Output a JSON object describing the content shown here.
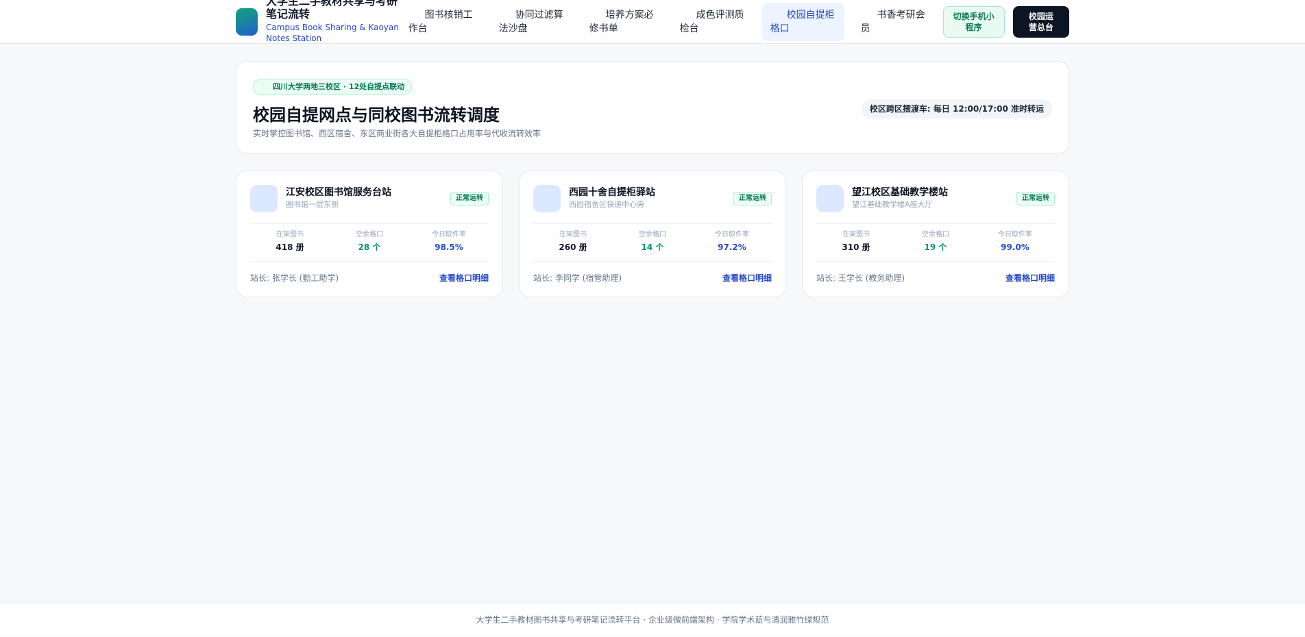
{
  "brand": {
    "title": "大学生二手教材共享与考研笔记流转",
    "subtitle": "Campus Book Sharing & Kaoyan Notes Station"
  },
  "nav": [
    {
      "label": "图书核销工作台",
      "active": false
    },
    {
      "label": "协同过滤算法沙盘",
      "active": false
    },
    {
      "label": "培养方案必修书单",
      "active": false
    },
    {
      "label": "成色评测质检台",
      "active": false
    },
    {
      "label": "校园自提柜格口",
      "active": true
    },
    {
      "label": "书香考研会员",
      "active": false
    }
  ],
  "header_actions": {
    "mini_program": "切换手机小程序",
    "ops": "校园运营总台"
  },
  "hero": {
    "badge": "四川大学两地三校区 · 12处自提点联动",
    "title": "校园自提网点与同校图书流转调度",
    "desc": "实时掌控图书馆、西区宿舍、东区商业街各大自提柜格口占用率与代收流转效率",
    "shuttle": "校区跨区摆渡车: 每日 12:00/17:00 准时转运"
  },
  "stations": [
    {
      "name": "江安校区图书馆服务台站",
      "location": "图书馆一层东侧",
      "status": "正常运转",
      "books_label": "在架图书",
      "books": "418 册",
      "free_label": "空余格口",
      "free": "28 个",
      "rate_label": "今日取件率",
      "rate": "98.5%",
      "manager": "站长: 张学长 (勤工助学)",
      "link": "查看格口明细"
    },
    {
      "name": "西园十舍自提柜驿站",
      "location": "西园宿舍区快递中心旁",
      "status": "正常运转",
      "books_label": "在架图书",
      "books": "260 册",
      "free_label": "空余格口",
      "free": "14 个",
      "rate_label": "今日取件率",
      "rate": "97.2%",
      "manager": "站长: 李同学 (宿管助理)",
      "link": "查看格口明细"
    },
    {
      "name": "望江校区基础教学楼站",
      "location": "望江基础教学楼A座大厅",
      "status": "正常运转",
      "books_label": "在架图书",
      "books": "310 册",
      "free_label": "空余格口",
      "free": "19 个",
      "rate_label": "今日取件率",
      "rate": "99.0%",
      "manager": "站长: 王学长 (教务助理)",
      "link": "查看格口明细"
    }
  ],
  "footer": "大学生二手教材图书共享与考研笔记流转平台 · 企业级微前端架构 · 学院学术蓝与清润雅竹绿规范",
  "colors": {
    "accent_blue": "#2548c9",
    "accent_green": "#059669",
    "dark": "#0d1424"
  }
}
